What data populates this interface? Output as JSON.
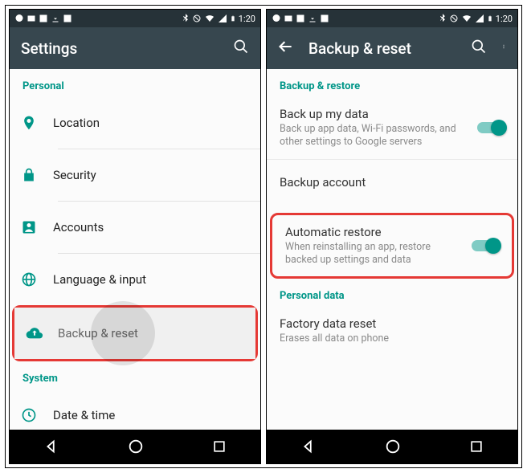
{
  "status": {
    "time": "1:20"
  },
  "left": {
    "title": "Settings",
    "sections": {
      "personal": "Personal",
      "system": "System"
    },
    "items": {
      "location": "Location",
      "security": "Security",
      "accounts": "Accounts",
      "language": "Language & input",
      "backup": "Backup & reset",
      "datetime": "Date & time"
    }
  },
  "right": {
    "title": "Backup & reset",
    "sections": {
      "backup": "Backup & restore",
      "personal": "Personal data"
    },
    "backup_my_data": {
      "label": "Back up my data",
      "sub": "Back up app data, Wi-Fi passwords, and other settings to Google servers"
    },
    "backup_account": {
      "label": "Backup account"
    },
    "auto_restore": {
      "label": "Automatic restore",
      "sub": "When reinstalling an app, restore backed up settings and data"
    },
    "factory_reset": {
      "label": "Factory data reset",
      "sub": "Erases all data on phone"
    }
  }
}
